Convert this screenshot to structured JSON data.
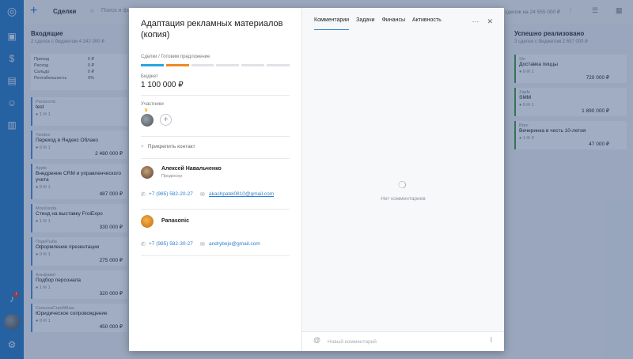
{
  "topbar": {
    "section": "Сделки",
    "search_placeholder": "Поиск и фи",
    "budget_total": "сделок на 24 555 000 ₽"
  },
  "columns": [
    {
      "title": "Входящие",
      "subtitle": "2 сделок с бюджетом 4 342 000 ₽",
      "summary": [
        [
          "Приход",
          "0 ₽"
        ],
        [
          "Расход",
          "0 ₽"
        ],
        [
          "Сальдо",
          "0 ₽"
        ],
        [
          "Рентабельность",
          "0%"
        ]
      ]
    },
    {
      "title": "Успешно реализовано",
      "subtitle": "3 сделок с бюджетом 2 657 000 ₽"
    }
  ],
  "left_cards": [
    {
      "company": "Panasonic",
      "title": "test",
      "meta": "● 1  ✉ 1",
      "price": ""
    },
    {
      "company": "Yandex",
      "title": "Переход в Яндекс Облако",
      "meta": "● 0  ✉ 1",
      "price": "2 480 000 ₽"
    },
    {
      "company": "Apple",
      "title": "Внедрение CRM и управленческого учета",
      "meta": "● 0  ✉ 1",
      "price": "487 000 ₽"
    },
    {
      "company": "MosXonda",
      "title": "Стенд на выставку FroiExpo",
      "meta": "● 1  ✉ 1",
      "price": "330 000 ₽"
    },
    {
      "company": "ПодеРыба",
      "title": "Оформление презентации",
      "meta": "● 0  ✉ 1",
      "price": "275 000 ₽"
    },
    {
      "company": "Альфавит",
      "title": "Подбор персонала",
      "meta": "● 1  ✉ 1",
      "price": "320 000 ₽"
    },
    {
      "company": "СельхозСтройМаш",
      "title": "Юридическое сопровождение",
      "meta": "● 0  ✉ 1",
      "price": "450 000 ₽"
    }
  ],
  "right_cards": [
    {
      "company": "Sin",
      "title": "Доставка пиццы",
      "meta": "● 0  ✉ 1",
      "price": "720 000 ₽"
    },
    {
      "company": "Zapfe",
      "title": "SMM",
      "meta": "● 0  ✉ 1",
      "price": "1 890 000 ₽"
    },
    {
      "company": "Brpo",
      "title": "Вечеринка в честь 10-летия",
      "meta": "● 1  ✉ 3",
      "price": "47 000 ₽"
    }
  ],
  "deal": {
    "title": "Адаптация рекламных материалов (копия)",
    "stage_label": "Сделки / Готовим предложение",
    "budget_label": "Бюджет",
    "budget_value": "1 100 000 ₽",
    "participants_label": "Участники",
    "add_participant": "+",
    "attach_contact": "Прикрепить контакт",
    "stage_colors": [
      "#2aa5e0",
      "#f08a24"
    ],
    "contacts": [
      {
        "name": "Алексей Навальченко",
        "role": "Продюсер",
        "phone": "+7 (985) 582-20-27",
        "email": "akashpatel0810@gmail.com"
      },
      {
        "name": "Panasonic",
        "role": "",
        "phone": "+7 (985) 582-30-27",
        "email": "andrybejo@gmail.com"
      }
    ]
  },
  "tabs": [
    "Комментарии",
    "Задачи",
    "Финансы",
    "Активность"
  ],
  "empty_state": "Нет комментариев",
  "comment_placeholder": "Новый комментарий",
  "icons": {
    "notification_count": "1"
  }
}
